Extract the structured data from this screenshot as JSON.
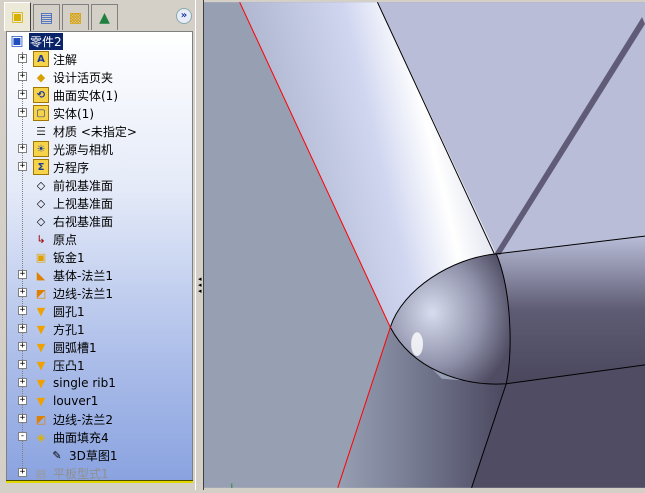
{
  "tabs": [
    {
      "name": "feature-manager",
      "icon": "part-icon"
    },
    {
      "name": "property-manager",
      "icon": "property-icon"
    },
    {
      "name": "configuration-manager",
      "icon": "configuration-icon"
    },
    {
      "name": "display-manager",
      "icon": "display-icon"
    }
  ],
  "more_label": "»",
  "tree": {
    "root": "零件2",
    "items": [
      {
        "label": "注解",
        "icon": "annotations-folder-icon",
        "expandable": true
      },
      {
        "label": "设计活页夹",
        "icon": "design-binder-icon",
        "expandable": true
      },
      {
        "label": "曲面实体(1)",
        "icon": "surface-bodies-folder-icon",
        "expandable": true
      },
      {
        "label": "实体(1)",
        "icon": "solid-bodies-folder-icon",
        "expandable": true
      },
      {
        "label": "材质 <未指定>",
        "icon": "material-icon",
        "expandable": false
      },
      {
        "label": "光源与相机",
        "icon": "lights-cameras-folder-icon",
        "expandable": true
      },
      {
        "label": "方程序",
        "icon": "equations-folder-icon",
        "expandable": true
      },
      {
        "label": "前视基准面",
        "icon": "plane-icon",
        "expandable": false
      },
      {
        "label": "上视基准面",
        "icon": "plane-icon",
        "expandable": false
      },
      {
        "label": "右视基准面",
        "icon": "plane-icon",
        "expandable": false
      },
      {
        "label": "原点",
        "icon": "origin-icon",
        "expandable": false
      },
      {
        "label": "钣金1",
        "icon": "sheet-metal-icon",
        "expandable": false
      },
      {
        "label": "基体-法兰1",
        "icon": "base-flange-icon",
        "expandable": true
      },
      {
        "label": "边线-法兰1",
        "icon": "edge-flange-icon",
        "expandable": true
      },
      {
        "label": "圆孔1",
        "icon": "forming-tool-icon",
        "expandable": true
      },
      {
        "label": "方孔1",
        "icon": "forming-tool-icon",
        "expandable": true
      },
      {
        "label": "圆弧槽1",
        "icon": "forming-tool-icon",
        "expandable": true
      },
      {
        "label": "压凸1",
        "icon": "forming-tool-icon",
        "expandable": true
      },
      {
        "label": "single rib1",
        "icon": "forming-tool-icon",
        "expandable": true
      },
      {
        "label": "louver1",
        "icon": "forming-tool-icon",
        "expandable": true
      },
      {
        "label": "边线-法兰2",
        "icon": "edge-flange-icon",
        "expandable": true
      },
      {
        "label": "曲面填充4",
        "icon": "filled-surface-icon",
        "expandable": true,
        "expanded": true
      },
      {
        "label": "3D草图1",
        "icon": "3d-sketch-icon",
        "expandable": false,
        "child": true
      },
      {
        "label": "平板型式1",
        "icon": "flat-pattern-icon",
        "expandable": true,
        "suppressed": true
      }
    ]
  },
  "colors": {
    "selection": "#0a246a",
    "edge_selected": "#ff0000",
    "plane_face": "#b9bdd8",
    "dark_face": "#4f4c63",
    "background_face": "#979fb3"
  }
}
